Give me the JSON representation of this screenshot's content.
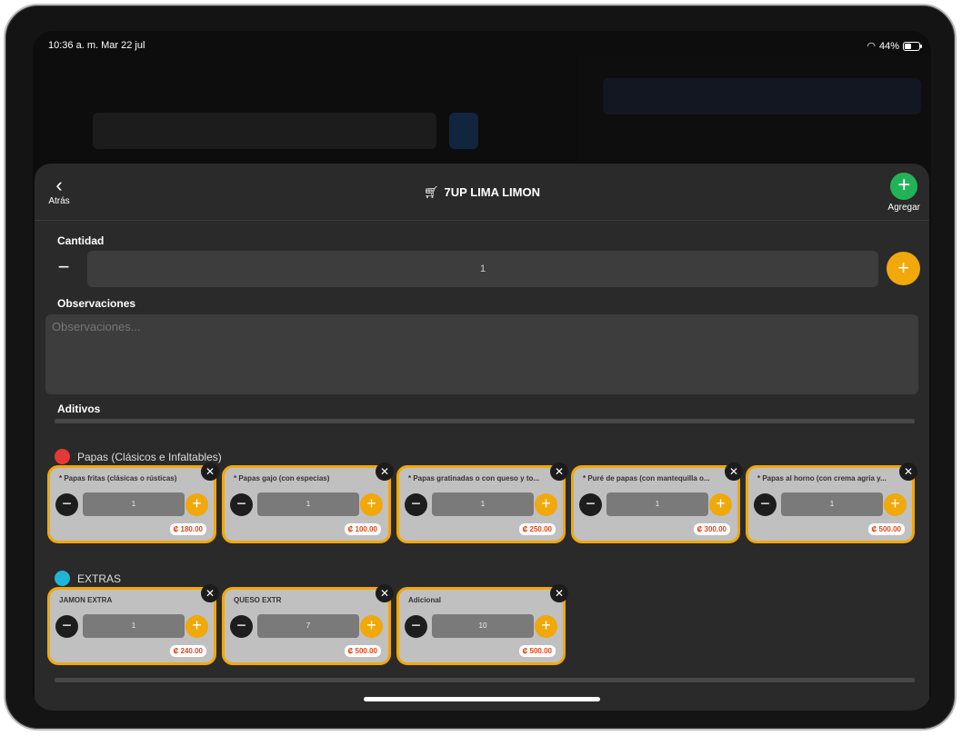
{
  "status_bar": {
    "time": "10:36 a. m.  Mar 22 jul",
    "battery": "44%",
    "wifi_icon": "wifi-icon"
  },
  "modal": {
    "back_label": "Atrás",
    "title": "7UP LIMA LIMON",
    "add_label": "Agregar",
    "cantidad_label": "Cantidad",
    "cantidad_value": "1",
    "observaciones_label": "Observaciones",
    "observaciones_placeholder": "Observaciones...",
    "aditivos_label": "Aditivos"
  },
  "groups": [
    {
      "name": "Papas (Clásicos e Infaltables)",
      "color": "#e53935",
      "items": [
        {
          "name": "* Papas fritas (clásicas o rústicas)",
          "qty": "1",
          "price": "₡ 180.00"
        },
        {
          "name": "* Papas gajo (con especias)",
          "qty": "1",
          "price": "₡ 100.00"
        },
        {
          "name": "* Papas gratinadas o con queso y to...",
          "qty": "1",
          "price": "₡ 250.00"
        },
        {
          "name": "* Puré de papas (con mantequilla o...",
          "qty": "1",
          "price": "₡ 300.00"
        },
        {
          "name": "* Papas al horno (con crema agria y...",
          "qty": "1",
          "price": "₡ 500.00"
        }
      ]
    },
    {
      "name": "EXTRAS",
      "color": "#1fb5d6",
      "items": [
        {
          "name": "JAMON EXTRA",
          "qty": "1",
          "price": "₡ 240.00"
        },
        {
          "name": "QUESO EXTR",
          "qty": "7",
          "price": "₡ 500.00"
        },
        {
          "name": "Adicional",
          "qty": "10",
          "price": "₡ 500.00"
        }
      ]
    }
  ]
}
